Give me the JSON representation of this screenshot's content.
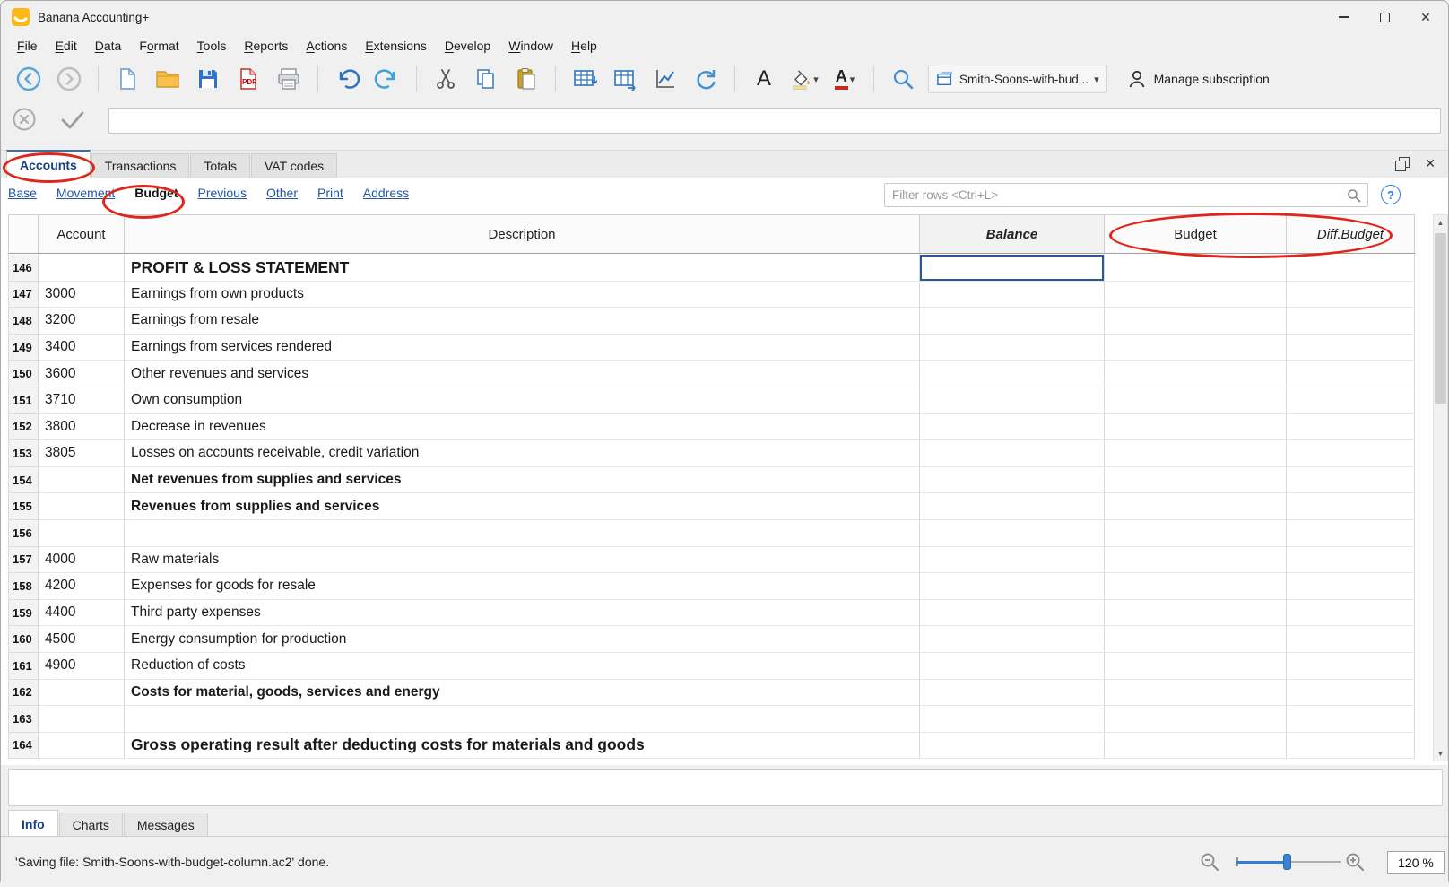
{
  "window": {
    "title": "Banana Accounting+"
  },
  "menu": {
    "items": [
      {
        "label": "File",
        "accel": 0
      },
      {
        "label": "Edit",
        "accel": 0
      },
      {
        "label": "Data",
        "accel": 0
      },
      {
        "label": "Format",
        "accel": 1
      },
      {
        "label": "Tools",
        "accel": 0
      },
      {
        "label": "Reports",
        "accel": 0
      },
      {
        "label": "Actions",
        "accel": 0
      },
      {
        "label": "Extensions",
        "accel": 0
      },
      {
        "label": "Develop",
        "accel": 0
      },
      {
        "label": "Window",
        "accel": 0
      },
      {
        "label": "Help",
        "accel": 0
      }
    ]
  },
  "toolbar": {
    "file_selector_label": "Smith-Soons-with-bud...",
    "manage_subscription_label": "Manage subscription"
  },
  "edit_bar": {
    "value": ""
  },
  "document_tabs": {
    "items": [
      {
        "label": "Accounts",
        "active": true
      },
      {
        "label": "Transactions",
        "active": false
      },
      {
        "label": "Totals",
        "active": false
      },
      {
        "label": "VAT codes",
        "active": false
      }
    ]
  },
  "view_bar": {
    "views": [
      {
        "label": "Base",
        "current": false
      },
      {
        "label": "Movement",
        "current": false
      },
      {
        "label": "Budget",
        "current": true
      },
      {
        "label": "Previous",
        "current": false
      },
      {
        "label": "Other",
        "current": false
      },
      {
        "label": "Print",
        "current": false
      },
      {
        "label": "Address",
        "current": false
      }
    ],
    "filter": {
      "placeholder": "Filter rows <Ctrl+L>"
    }
  },
  "table": {
    "columns": [
      "Account",
      "Description",
      "Balance",
      "Budget",
      "Diff.Budget"
    ],
    "rows": [
      {
        "num": "146",
        "account": "",
        "description": "PROFIT & LOSS STATEMENT",
        "style": "section",
        "selected": "balance"
      },
      {
        "num": "147",
        "account": "3000",
        "description": "Earnings from own products",
        "style": "normal"
      },
      {
        "num": "148",
        "account": "3200",
        "description": "Earnings from resale",
        "style": "normal"
      },
      {
        "num": "149",
        "account": "3400",
        "description": "Earnings from services rendered",
        "style": "normal"
      },
      {
        "num": "150",
        "account": "3600",
        "description": "Other revenues and services",
        "style": "normal"
      },
      {
        "num": "151",
        "account": "3710",
        "description": "Own consumption",
        "style": "normal"
      },
      {
        "num": "152",
        "account": "3800",
        "description": "Decrease in revenues",
        "style": "normal"
      },
      {
        "num": "153",
        "account": "3805",
        "description": "Losses on accounts receivable, credit variation",
        "style": "normal"
      },
      {
        "num": "154",
        "account": "",
        "description": "Net revenues from supplies and services",
        "style": "bold"
      },
      {
        "num": "155",
        "account": "",
        "description": "Revenues from supplies and services",
        "style": "bold"
      },
      {
        "num": "156",
        "account": "",
        "description": "",
        "style": "normal"
      },
      {
        "num": "157",
        "account": "4000",
        "description": "Raw materials",
        "style": "normal"
      },
      {
        "num": "158",
        "account": "4200",
        "description": "Expenses for goods for resale",
        "style": "normal"
      },
      {
        "num": "159",
        "account": "4400",
        "description": "Third party expenses",
        "style": "normal"
      },
      {
        "num": "160",
        "account": "4500",
        "description": "Energy consumption for production",
        "style": "normal"
      },
      {
        "num": "161",
        "account": "4900",
        "description": "Reduction of costs",
        "style": "normal"
      },
      {
        "num": "162",
        "account": "",
        "description": "Costs for material, goods, services and energy",
        "style": "bold"
      },
      {
        "num": "163",
        "account": "",
        "description": "",
        "style": "normal"
      },
      {
        "num": "164",
        "account": "",
        "description": "Gross operating result after deducting costs for materials and goods",
        "style": "section"
      }
    ]
  },
  "bottom_tabs": {
    "items": [
      {
        "label": "Info",
        "active": true
      },
      {
        "label": "Charts",
        "active": false
      },
      {
        "label": "Messages",
        "active": false
      }
    ]
  },
  "status_bar": {
    "message": "'Saving file: Smith-Soons-with-budget-column.ac2' done.",
    "zoom_value": "120 %"
  },
  "annotations": {
    "shape": "red-ellipse",
    "targets": [
      "accounts-tab",
      "budget-view-link",
      "budget-and-diffbudget-column-headers"
    ]
  },
  "icons": {
    "close": "✕",
    "help_question": "?",
    "dropdown_arrow": "▾",
    "arrow_up": "▲",
    "arrow_down": "▼",
    "font_a": "A",
    "font_color_a": "A"
  },
  "colors": {
    "accent_blue": "#2f74c0",
    "active_tab_blue": "#14427d",
    "link_blue": "#2456a4",
    "annotation_red": "#e0261b",
    "selection_blue": "#2b5797",
    "folder_orange": "#f8c04a"
  }
}
